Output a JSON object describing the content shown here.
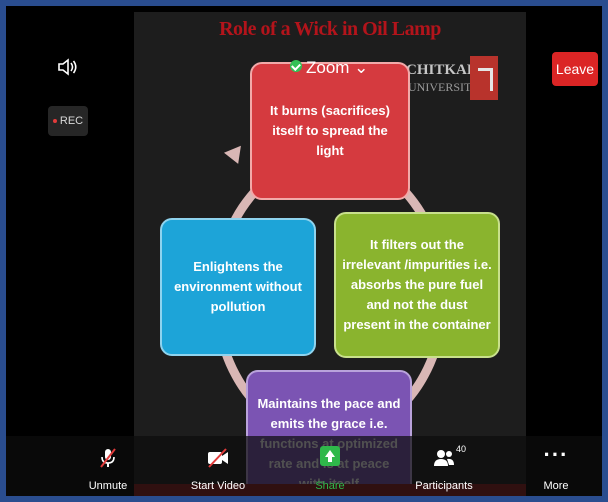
{
  "slide": {
    "title": "Role of a Wick in Oil Lamp",
    "logo_name": "CHITKARA",
    "logo_sub": "UNIVERSITY",
    "boxes": {
      "top": "It burns (sacrifices) itself to spread the light",
      "left": "Enlightens the environment without pollution",
      "right": "It filters out the irrelevant /impurities i.e. absorbs the pure fuel and not the dust present in the container",
      "bottom": "Maintains the pace and emits the grace i.e. functions at optimized rate and is at peace with itself"
    }
  },
  "zoom": {
    "label": "Zoom ⌄",
    "rec_label": "REC",
    "leave_label": "Leave",
    "toolbar": {
      "unmute": "Unmute",
      "start_video": "Start Video",
      "share": "Share",
      "participants": "Participants",
      "participants_count": "40",
      "more": "More"
    }
  },
  "colors": {
    "leave": "#db2525",
    "share": "#2fb84a",
    "box_top": "#d53a3f",
    "box_left": "#1da4d8",
    "box_right": "#8ab42e",
    "box_bottom": "#7b54b3"
  }
}
